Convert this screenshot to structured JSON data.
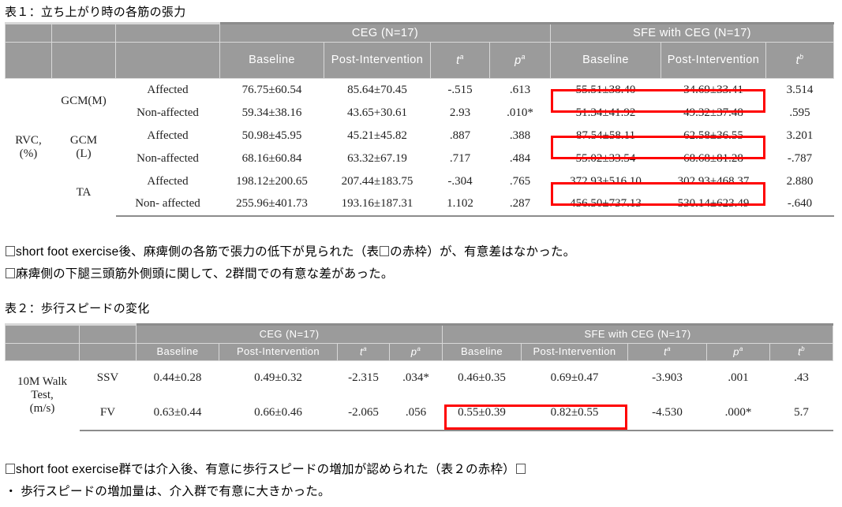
{
  "captions": {
    "table1": "表１：立ち上がり時の各筋の張力",
    "table2": "表２：歩行スピードの変化"
  },
  "table1": {
    "groups": [
      {
        "label": "CEG (N=17)",
        "n": "17"
      },
      {
        "label": "SFE with CEG (N=17)",
        "n": "17"
      }
    ],
    "subheaders_ceg": [
      "Baseline",
      "Post-Intervention",
      "t",
      "p"
    ],
    "subheaders_sfe": [
      "Baseline",
      "Post-Intervention",
      "t"
    ],
    "sup_marks": {
      "t_a": "a",
      "p_a": "a",
      "t_b": "b"
    },
    "row_group_label": "RVC, (%)",
    "row_group_label_line1": "RVC,",
    "row_group_label_line2": "(%)",
    "muscles": [
      "GCM(M)",
      "GCM (L)",
      "TA"
    ],
    "muscle_lines": [
      {
        "l1": "GCM(M)",
        "l2": ""
      },
      {
        "l1": "GCM",
        "l2": "(L)"
      },
      {
        "l1": "TA",
        "l2": ""
      }
    ],
    "rows": [
      {
        "side": "Affected",
        "ceg_baseline": "76.75±60.54",
        "ceg_post": "85.64±70.45",
        "ceg_t": "-.515",
        "ceg_p": ".613",
        "sfe_baseline": "55.51±38.40",
        "sfe_post": "34.69±33.41",
        "sfe_t": "3.514",
        "highlight": true
      },
      {
        "side": "Non-affected",
        "ceg_baseline": "59.34±38.16",
        "ceg_post": "43.65+30.61",
        "ceg_t": "2.93",
        "ceg_p": ".010*",
        "sfe_baseline": "51.34±41.92",
        "sfe_post": "49.32±37.48",
        "sfe_t": ".595",
        "highlight": false
      },
      {
        "side": "Affected",
        "ceg_baseline": "50.98±45.95",
        "ceg_post": "45.21±45.82",
        "ceg_t": ".887",
        "ceg_p": ".388",
        "sfe_baseline": "87.54±58.11",
        "sfe_post": "62.58±36.55",
        "sfe_t": "3.201",
        "highlight": true
      },
      {
        "side": "Non-affected",
        "ceg_baseline": "68.16±60.84",
        "ceg_post": "63.32±67.19",
        "ceg_t": ".717",
        "ceg_p": ".484",
        "sfe_baseline": "55.02±33.54",
        "sfe_post": "68.68±81.28",
        "sfe_t": "-.787",
        "highlight": false
      },
      {
        "side": "Affected",
        "ceg_baseline": "198.12±200.65",
        "ceg_post": "207.44±183.75",
        "ceg_t": "-.304",
        "ceg_p": ".765",
        "sfe_baseline": "372.93±516.10",
        "sfe_post": "302.93±468.37",
        "sfe_t": "2.880",
        "highlight": true
      },
      {
        "side": "Non- affected",
        "ceg_baseline": "255.96±401.73",
        "ceg_post": "193.16±187.31",
        "ceg_t": "1.102",
        "ceg_p": ".287",
        "sfe_baseline": "456.50±737.13",
        "sfe_post": "530.14±623.49",
        "sfe_t": "-.640",
        "highlight": false
      }
    ]
  },
  "table2": {
    "groups": [
      {
        "label": "CEG (N=17)"
      },
      {
        "label": "SFE with CEG (N=17)"
      }
    ],
    "subheaders_ceg": [
      "Baseline",
      "Post-Intervention",
      "t",
      "p"
    ],
    "subheaders_sfe": [
      "Baseline",
      "Post-Intervention",
      "t",
      "p",
      "t"
    ],
    "row_label_line1": "10M Walk",
    "row_label_line2": "Test,",
    "row_label_line3": "(m/s)",
    "rows": [
      {
        "measure": "SSV",
        "ceg_baseline": "0.44±0.28",
        "ceg_post": "0.49±0.32",
        "ceg_t": "-2.315",
        "ceg_p": ".034*",
        "sfe_baseline": "0.46±0.35",
        "sfe_post": "0.69±0.47",
        "sfe_t": "-3.903",
        "sfe_p": ".001",
        "sfe_tb": ".43",
        "highlight": false
      },
      {
        "measure": "FV",
        "ceg_baseline": "0.63±0.44",
        "ceg_post": "0.66±0.46",
        "ceg_t": "-2.065",
        "ceg_p": ".056",
        "sfe_baseline": "0.55±0.39",
        "sfe_post": "0.82±0.55",
        "sfe_t": "-4.530",
        "sfe_p": ".000*",
        "sfe_tb": "5.7",
        "highlight": true
      }
    ]
  },
  "notes": {
    "n1a_pre": "short foot exercise後、麻痺側の各筋で張力の低下が見られた（表",
    "n1a_post": "の赤枠）が、有意差はなかった。",
    "n1b": "麻痺側の下腿三頭筋外側頭に関して、2群間での有意な差があった。",
    "n2a_pre": "short foot exercise群では介入後、有意に歩行スピードの増加が認められた（表２の赤枠）",
    "n2b": "・ 歩行スピードの増加量は、介入群で有意に大きかった。"
  },
  "colors": {
    "header_bg": "#9b9b9b",
    "header_text": "#ffffff",
    "highlight": "#ff0000",
    "rule": "#8c8c8c",
    "body_text": "#222222"
  }
}
